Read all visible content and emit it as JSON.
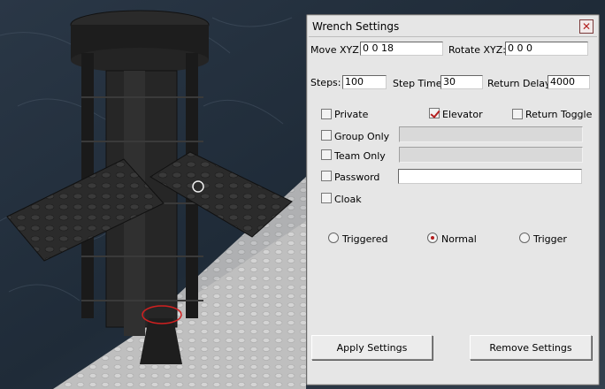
{
  "dialog": {
    "title": "Wrench Settings",
    "close_label": "✕",
    "move_label": "Move XYZ:",
    "move_value": "0 0 18",
    "rotate_label": "Rotate XYZ:",
    "rotate_value": "0 0 0",
    "steps_label": "Steps:",
    "steps_value": "100",
    "step_time_label": "Step Time:",
    "step_time_value": "30",
    "return_delay_label": "Return Delay:",
    "return_delay_value": "4000",
    "private_label": "Private",
    "private_checked": false,
    "elevator_label": "Elevator",
    "elevator_checked": true,
    "return_toggle_label": "Return Toggle",
    "return_toggle_checked": false,
    "group_only_label": "Group Only",
    "team_only_label": "Team Only",
    "password_label": "Password",
    "cloak_label": "Cloak",
    "mode_options": [
      "Triggered",
      "Normal",
      "Trigger"
    ],
    "mode_selected": "Normal",
    "apply_label": "Apply Settings",
    "remove_label": "Remove Settings"
  },
  "colors": {
    "dialog_bg": "#e6e6e6",
    "check_accent": "#b41e1e"
  }
}
